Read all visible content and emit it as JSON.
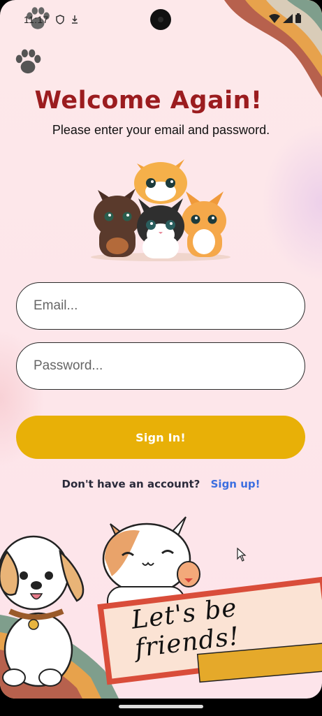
{
  "status_bar": {
    "time": "11:17"
  },
  "login": {
    "title": "Welcome Again!",
    "subtitle": "Please enter your email and password.",
    "email_placeholder": "Email...",
    "password_placeholder": "Password...",
    "signin_label": "Sign In!",
    "signup_prompt": "Don't have an account?",
    "signup_link": "Sign up!"
  },
  "banner": {
    "text": "Let's be friends!"
  },
  "colors": {
    "title": "#9b1c1f",
    "button": "#e8b007",
    "link": "#3b6ee0",
    "background": "#fde8ea"
  },
  "icons": [
    "shield-icon",
    "download-icon",
    "wifi-icon",
    "signal-icon",
    "battery-icon",
    "paw-icon"
  ]
}
